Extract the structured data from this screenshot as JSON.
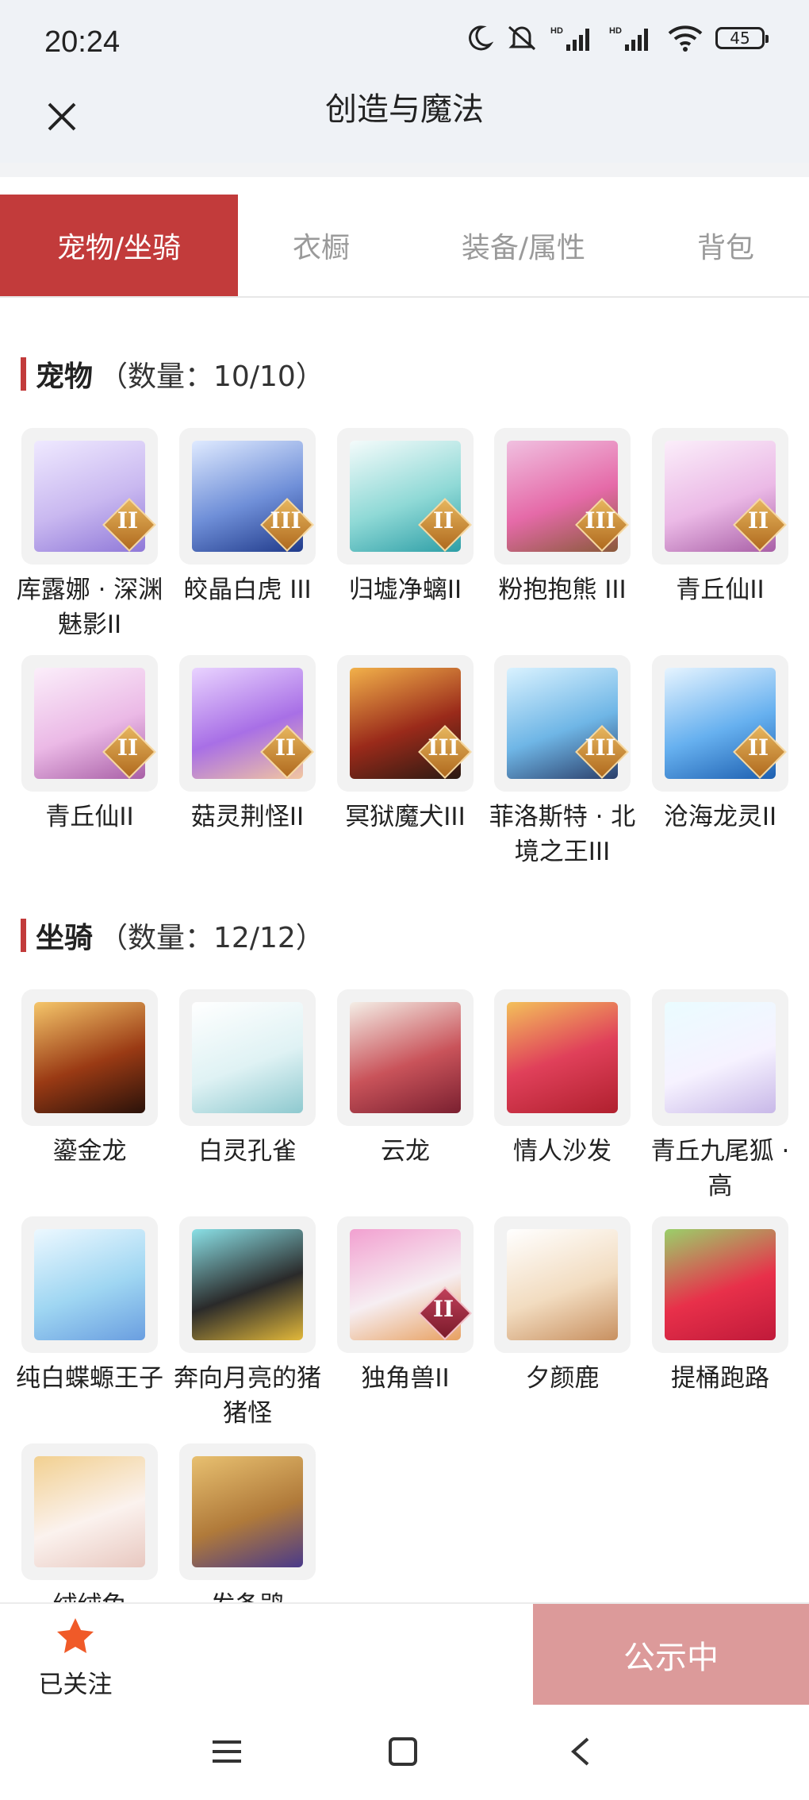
{
  "status": {
    "time": "20:24",
    "battery": "45",
    "icons": [
      "moon-icon",
      "mute-icon",
      "hd-signal-icon",
      "hd-signal-icon",
      "wifi-icon",
      "battery-icon"
    ]
  },
  "header": {
    "title": "创造与魔法",
    "close_icon": "close-icon"
  },
  "tabs": [
    {
      "label": "宠物/坐骑",
      "active": true
    },
    {
      "label": "衣橱"
    },
    {
      "label": "装备/属性"
    },
    {
      "label": "背包"
    }
  ],
  "pets": {
    "title": "宠物",
    "count": "（数量：10/10）",
    "items": [
      {
        "label": "库露娜 · 深渊魅影II",
        "badge": "II"
      },
      {
        "label": "皎晶白虎 III",
        "badge": "III"
      },
      {
        "label": "归墟净螭II",
        "badge": "II"
      },
      {
        "label": "粉抱抱熊 III",
        "badge": "III"
      },
      {
        "label": "青丘仙II",
        "badge": "II"
      },
      {
        "label": "青丘仙II",
        "badge": "II"
      },
      {
        "label": "菇灵荆怪II",
        "badge": "II"
      },
      {
        "label": "冥狱魔犬III",
        "badge": "III"
      },
      {
        "label": "菲洛斯特 · 北境之王III",
        "badge": "III"
      },
      {
        "label": "沧海龙灵II",
        "badge": "II"
      }
    ]
  },
  "mounts": {
    "title": "坐骑",
    "count": "（数量：12/12）",
    "items": [
      {
        "label": "鎏金龙"
      },
      {
        "label": "白灵孔雀"
      },
      {
        "label": "云龙"
      },
      {
        "label": "情人沙发"
      },
      {
        "label": "青丘九尾狐 · 高"
      },
      {
        "label": "纯白蝶螈王子"
      },
      {
        "label": "奔向月亮的猪猪怪"
      },
      {
        "label": "独角兽II",
        "badge": "II"
      },
      {
        "label": "夕颜鹿"
      },
      {
        "label": "提桶跑路"
      },
      {
        "label": "绒绒兔"
      },
      {
        "label": "发条鸮"
      }
    ]
  },
  "bottom": {
    "follow_label": "已关注",
    "follow_icon": "star-icon",
    "public_label": "公示中"
  },
  "navbar": {
    "icons": [
      "menu-icon",
      "home-icon",
      "back-icon"
    ]
  },
  "colors": {
    "accent": "#c23b3b",
    "public_button": "#dc9a9a",
    "star": "#f05a28",
    "status_bg": "#eff2f6"
  }
}
